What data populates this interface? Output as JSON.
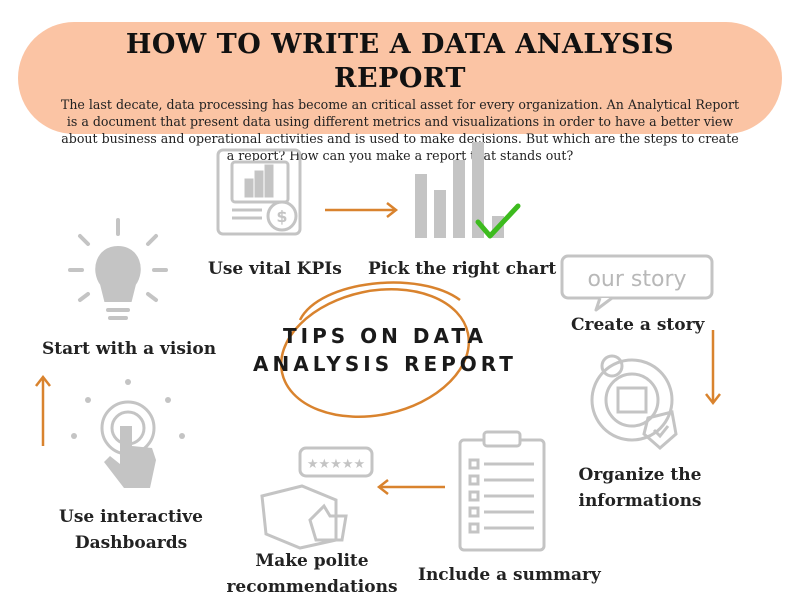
{
  "header": {
    "title": "HOW TO WRITE A DATA ANALYSIS REPORT",
    "intro": "The last decate, data processing has become an critical asset for every organization. An Analytical Report is a document that present data using different metrics and visualizations in order to have a better view about business and operational activities and is used to make decisions. But which are the steps to create a report? How can you make a report that stands out?"
  },
  "center": {
    "line1": "TIPS ON DATA",
    "line2": "ANALYSIS REPORT"
  },
  "story_card_text": "our story",
  "steps": [
    {
      "label": "Use vital KPIs"
    },
    {
      "label": "Pick the right chart"
    },
    {
      "label": "Create a story"
    },
    {
      "label_line1": "Organize the",
      "label_line2": "informations"
    },
    {
      "label": "Include a summary"
    },
    {
      "label_line1": "Make polite",
      "label_line2": "recommendations"
    },
    {
      "label_line1": "Use interactive",
      "label_line2": "Dashboards"
    },
    {
      "label": "Start with a vision"
    }
  ],
  "colors": {
    "banner": "#fbc4a4",
    "accent_orange": "#d9832e",
    "icon_gray": "#c4c4c4",
    "check_green": "#3dbb1e"
  }
}
